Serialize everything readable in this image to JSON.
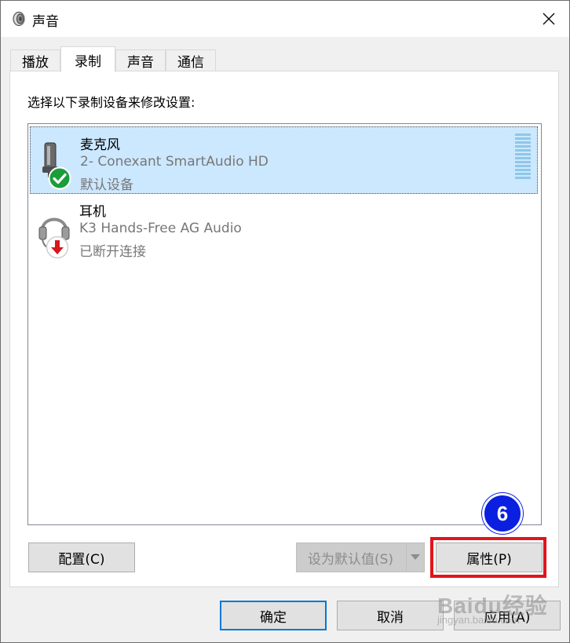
{
  "window": {
    "title": "声音",
    "close_glyph": "✕"
  },
  "tabs": [
    {
      "label": "播放",
      "active": false
    },
    {
      "label": "录制",
      "active": true
    },
    {
      "label": "声音",
      "active": false
    },
    {
      "label": "通信",
      "active": false
    }
  ],
  "instruction": "选择以下录制设备来修改设置:",
  "devices": [
    {
      "name": "麦克风",
      "description": "2- Conexant SmartAudio HD",
      "status": "默认设备",
      "icon": "microphone-icon",
      "badge": "green-check-icon",
      "selected": true
    },
    {
      "name": "耳机",
      "description": "K3 Hands-Free AG Audio",
      "status": "已断开连接",
      "icon": "headset-icon",
      "badge": "red-down-arrow-icon",
      "selected": false
    }
  ],
  "buttons": {
    "configure": "配置(C)",
    "set_default": "设为默认值(S)",
    "properties": "属性(P)",
    "ok": "确定",
    "cancel": "取消",
    "apply": "应用(A)"
  },
  "annotation": {
    "step": "6",
    "highlight_color": "#e2141c",
    "badge_color": "#0a1fe0"
  },
  "watermark": {
    "main": "Baidu经验",
    "sub": "jingyan.baidu.com"
  },
  "colors": {
    "selection": "#cce8ff",
    "accent": "#0078d7"
  }
}
